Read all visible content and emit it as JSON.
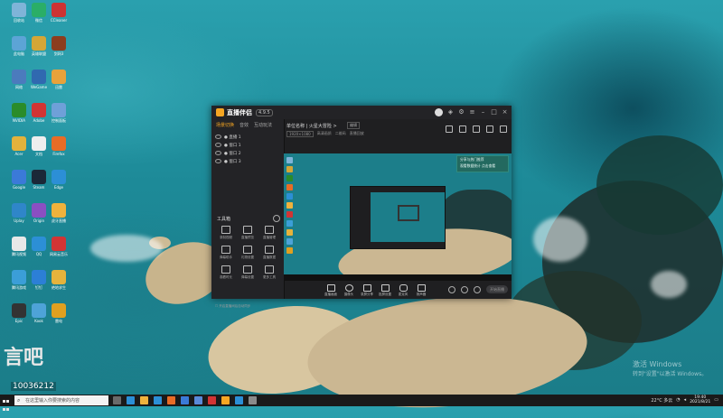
{
  "desktop": {
    "icons": [
      {
        "label": "回收站",
        "color": "#7fb4d8"
      },
      {
        "label": "微信",
        "color": "#2aae67"
      },
      {
        "label": "CCleaner",
        "color": "#cc3333"
      },
      {
        "label": "此电脑",
        "color": "#5ca4d6"
      },
      {
        "label": "英雄联盟",
        "color": "#d4a637"
      },
      {
        "label": "剑网3",
        "color": "#8c3d1e"
      },
      {
        "label": "网络",
        "color": "#4b7bbd"
      },
      {
        "label": "WeGame",
        "color": "#3069b0"
      },
      {
        "label": "迅雷",
        "color": "#e8a23b"
      },
      {
        "label": "NVIDIA",
        "color": "#2a8c2a"
      },
      {
        "label": "Adobe",
        "color": "#d23434"
      },
      {
        "label": "控制面板",
        "color": "#6fa0d8"
      },
      {
        "label": "Acer",
        "color": "#e3b23c"
      },
      {
        "label": "文档",
        "color": "#eeeeee"
      },
      {
        "label": "Firefox",
        "color": "#e86c26"
      },
      {
        "label": "Google",
        "color": "#3b7ad8"
      },
      {
        "label": "Steam",
        "color": "#1b2838"
      },
      {
        "label": "Edge",
        "color": "#2c8fd6"
      },
      {
        "label": "Uplay",
        "color": "#2f86c9"
      },
      {
        "label": "Origin",
        "color": "#8a4fc2"
      },
      {
        "label": "虎牙直播",
        "color": "#f0b23c"
      },
      {
        "label": "腾讯视频",
        "color": "#e8e8e8"
      },
      {
        "label": "QQ",
        "color": "#2c8fd6"
      },
      {
        "label": "网易云音乐",
        "color": "#d23434"
      },
      {
        "label": "腾讯游戏",
        "color": "#3b9ed8"
      },
      {
        "label": "钉钉",
        "color": "#2c7fd6"
      },
      {
        "label": "绝地求生",
        "color": "#e6b33c"
      },
      {
        "label": "Epic",
        "color": "#333333"
      },
      {
        "label": "Kook",
        "color": "#4ea3d8"
      },
      {
        "label": "雷电",
        "color": "#e0a020"
      }
    ],
    "widget": {
      "glyph": "言吧",
      "number": "10036212"
    },
    "watermark": {
      "line1": "激活 Windows",
      "line2": "转到\"设置\"以激活 Windows。"
    }
  },
  "app": {
    "name": "直播伴侣",
    "version": "4.9.5",
    "sidebar": {
      "tabs": [
        "场景切换",
        "音效",
        "互动玩法"
      ],
      "scenes": [
        "● 直播 1",
        "● 窗口 1",
        "● 窗口 2",
        "● 窗口 3"
      ],
      "tools_title": "工具箱",
      "tools": [
        "录制视频",
        "直播预览",
        "直播管理",
        "弹幕助手",
        "礼物设置",
        "直播数据",
        "观看时长",
        "弹幕设置",
        "更多工具"
      ],
      "footer": "☐ 开启直播间后自动同步"
    },
    "main": {
      "title": "单位名称 | 火星大冒险 >",
      "edit": "编辑",
      "meta": [
        "1920×1080",
        "高清画质",
        "二维码",
        "直播回放"
      ],
      "notice_line1": "分享与热门推荐",
      "notice_line2": "观看数据统计 点击查看"
    },
    "controls": [
      "直播画面",
      "摄像头",
      "录屏分享",
      "投屏设置",
      "麦克风",
      "扬声器"
    ],
    "start_label": "开始直播"
  },
  "taskbar": {
    "search_placeholder": "在这里输入你要搜索的内容",
    "apps": [
      {
        "color": "#6a6a6a"
      },
      {
        "color": "#2c8fd6"
      },
      {
        "color": "#f0b23c"
      },
      {
        "color": "#2c8fd6"
      },
      {
        "color": "#e86c26"
      },
      {
        "color": "#3b7ad8"
      },
      {
        "color": "#5a8ad8"
      },
      {
        "color": "#d23434"
      },
      {
        "color": "#f5a623"
      },
      {
        "color": "#2c8fd6"
      },
      {
        "color": "#8a8a8a"
      }
    ],
    "tray_text": "22°C 多云",
    "time": "19:40",
    "date": "2021/8/21"
  }
}
